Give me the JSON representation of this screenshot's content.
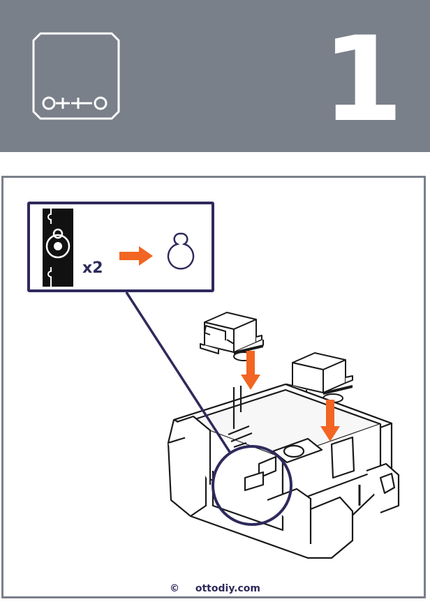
{
  "header": {
    "logo_text": "o++o",
    "step_number": "1"
  },
  "callout": {
    "quantity_label": "x2"
  },
  "footer": {
    "copyright_symbol": "©",
    "website": "ottodiy.com"
  },
  "colors": {
    "header_background": "#7a808a",
    "accent_arrow": "#f26522",
    "outline_navy": "#2e2a5c"
  },
  "icons": [
    "otto-logo-icon",
    "servo-horn-icon",
    "keyhole-hole-icon",
    "arrow-right-icon",
    "arrow-down-icon",
    "servo-motor-icon",
    "robot-body-icon"
  ]
}
